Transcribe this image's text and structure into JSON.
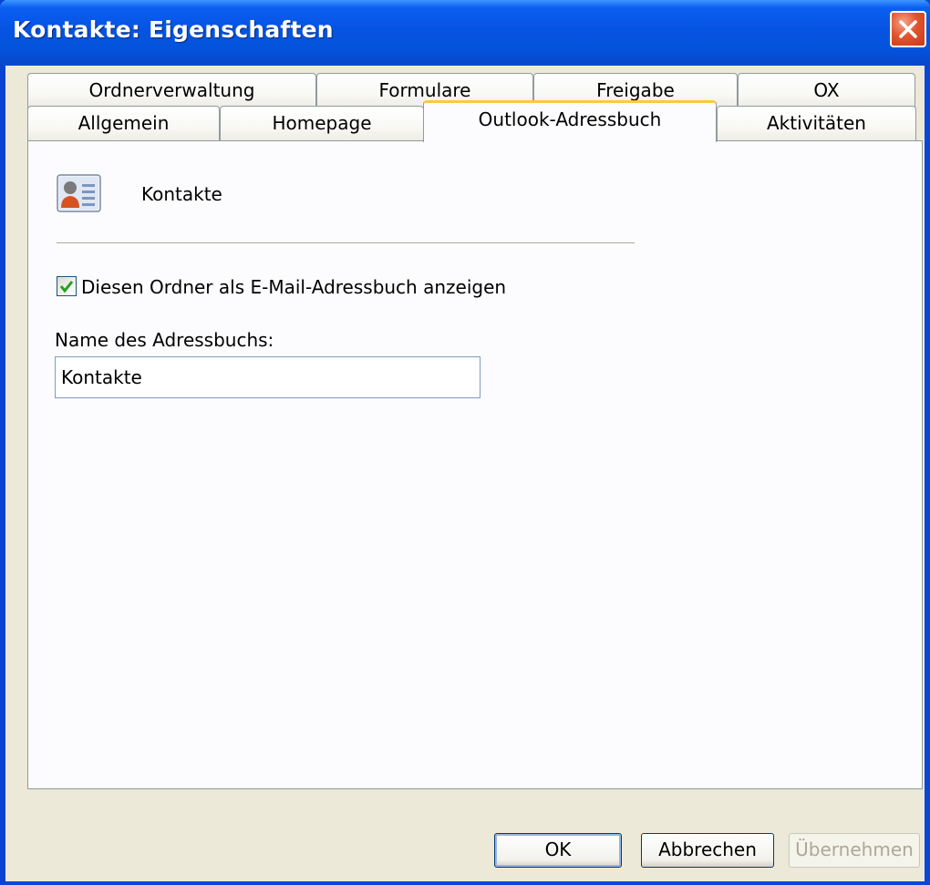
{
  "window": {
    "title": "Kontakte: Eigenschaften"
  },
  "tabs": {
    "row_back": [
      {
        "label": "Ordnerverwaltung"
      },
      {
        "label": "Formulare"
      },
      {
        "label": "Freigabe"
      },
      {
        "label": "OX"
      }
    ],
    "row_front": [
      {
        "label": "Allgemein"
      },
      {
        "label": "Homepage"
      },
      {
        "label": "Outlook-Adressbuch",
        "active": true
      },
      {
        "label": "Aktivitäten"
      }
    ]
  },
  "panel": {
    "icon": "contact-card-icon",
    "folder_name": "Kontakte",
    "checkbox": {
      "label": "Diesen Ordner als E-Mail-Adressbuch anzeigen",
      "checked": true
    },
    "name_label": "Name des Adressbuchs:",
    "name_value": "Kontakte"
  },
  "buttons": {
    "ok": "OK",
    "cancel": "Abbrechen",
    "apply": "Übernehmen"
  },
  "colors": {
    "titlebar": "#0453dc",
    "active_tab_accent": "#ffc83c",
    "check_mark": "#21a121"
  }
}
